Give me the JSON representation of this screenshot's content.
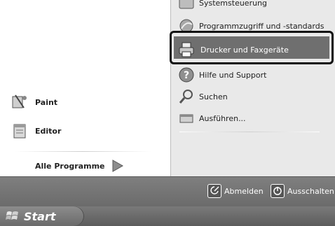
{
  "left_pane": {
    "items": [
      {
        "label": "Paint",
        "icon": "paint-icon"
      },
      {
        "label": "Editor",
        "icon": "notepad-icon"
      }
    ],
    "all_programs": {
      "label": "Alle Programme",
      "icon": "arrow-right-icon"
    }
  },
  "right_pane": {
    "items": [
      {
        "label": "Systemsteuerung",
        "icon": "control-panel-icon"
      },
      {
        "label": "Programmzugriff und -standards",
        "icon": "program-access-icon"
      },
      {
        "label": "Drucker und Faxgeräte",
        "icon": "printer-icon"
      },
      {
        "label": "Hilfe und Support",
        "icon": "help-icon"
      },
      {
        "label": "Suchen",
        "icon": "search-icon"
      },
      {
        "label": "Ausführen...",
        "icon": "run-icon"
      }
    ]
  },
  "bottom_band": {
    "logoff": {
      "label": "Abmelden",
      "icon": "logoff-icon"
    },
    "shutdown": {
      "label": "Ausschalten",
      "icon": "power-icon"
    }
  },
  "taskbar": {
    "start_label": "Start",
    "start_icon": "windows-logo-icon"
  }
}
